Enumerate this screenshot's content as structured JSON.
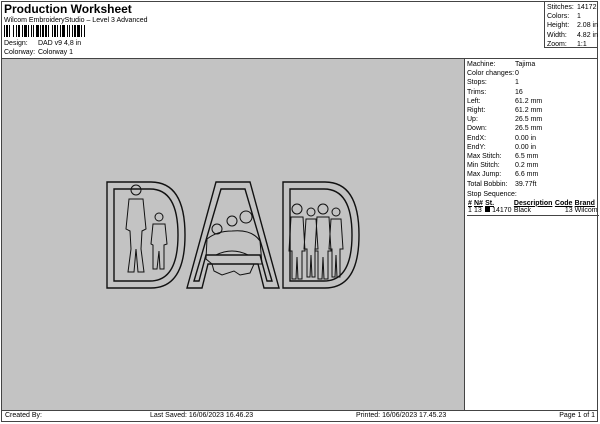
{
  "header": {
    "title": "Production Worksheet",
    "subtitle": "Wilcom EmbroideryStudio – Level 3 Advanced"
  },
  "meta": {
    "design_label": "Design:",
    "design_value": "DAD v9 4,8 in",
    "colorway_label": "Colorway:",
    "colorway_value": "Colorway 1"
  },
  "top_stats": [
    {
      "label": "Stitches:",
      "value": "14172"
    },
    {
      "label": "Colors:",
      "value": "1"
    },
    {
      "label": "Height:",
      "value": "2.08 in"
    },
    {
      "label": "Width:",
      "value": "4.82 in"
    },
    {
      "label": "Zoom:",
      "value": "1:1"
    }
  ],
  "machine_stats": [
    {
      "label": "Machine:",
      "value": "Tajima"
    },
    {
      "label": "Color changes:",
      "value": "0"
    },
    {
      "label": "Stops:",
      "value": "1"
    },
    {
      "label": "Trims:",
      "value": "16"
    },
    {
      "label": "Left:",
      "value": "61.2 mm"
    },
    {
      "label": "Right:",
      "value": "61.2 mm"
    },
    {
      "label": "Up:",
      "value": "26.5 mm"
    },
    {
      "label": "Down:",
      "value": "26.5 mm"
    },
    {
      "label": "EndX:",
      "value": "0.00 in"
    },
    {
      "label": "EndY:",
      "value": "0.00 in"
    },
    {
      "label": "Max Stitch:",
      "value": "6.5 mm"
    },
    {
      "label": "Min Stitch:",
      "value": "0.2 mm"
    },
    {
      "label": "Max Jump:",
      "value": "6.6 mm"
    },
    {
      "label": "Total Bobbin:",
      "value": "39.77ft"
    }
  ],
  "stop_sequence": {
    "label": "Stop Sequence:",
    "headers": [
      "#",
      "N#",
      "St.",
      "Description",
      "Code",
      "Brand"
    ],
    "rows": [
      {
        "num": "1",
        "n": "13",
        "st": "14170",
        "desc": "Black",
        "code": "13",
        "brand": "Wilcom",
        "color": "#000000"
      }
    ]
  },
  "footer": {
    "created": "Created By:",
    "last_saved": "Last Saved: 16/06/2023 16.46.23",
    "printed": "Printed: 16/06/2023 17.45.23",
    "page": "Page 1 of 1"
  },
  "colors": {
    "canvas_bg": "#c3c3c3",
    "outline": "#111111"
  }
}
